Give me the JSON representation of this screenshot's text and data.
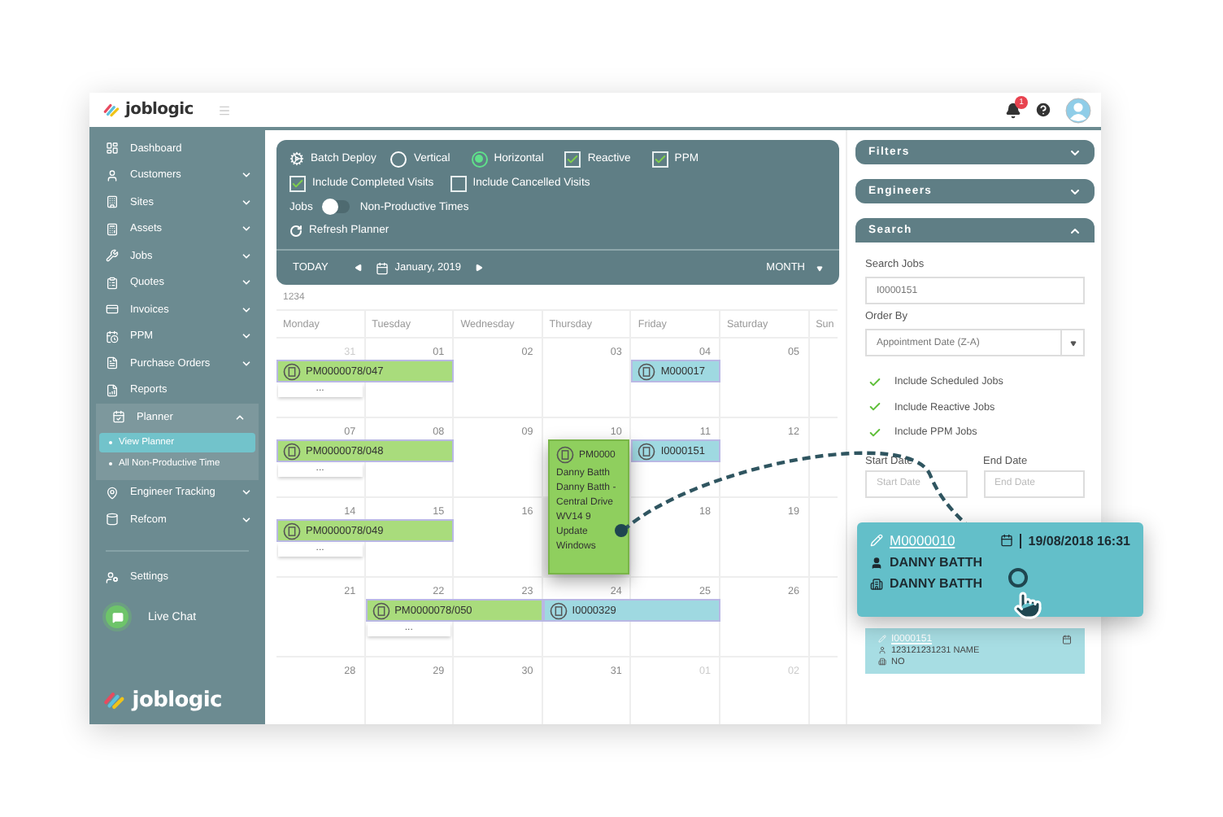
{
  "header": {
    "logo": "joblogic",
    "notifications": "1"
  },
  "sidebar": {
    "items": [
      {
        "label": "Dashboard",
        "kind": "link"
      },
      {
        "label": "Customers",
        "kind": "group",
        "expanded": false
      },
      {
        "label": "Sites",
        "kind": "group",
        "expanded": false
      },
      {
        "label": "Assets",
        "kind": "group",
        "expanded": false
      },
      {
        "label": "Jobs",
        "kind": "group",
        "expanded": false
      },
      {
        "label": "Quotes",
        "kind": "group",
        "expanded": false
      },
      {
        "label": "Invoices",
        "kind": "group",
        "expanded": false
      },
      {
        "label": "PPM",
        "kind": "group",
        "expanded": false
      },
      {
        "label": "Purchase Orders",
        "kind": "group",
        "expanded": false
      },
      {
        "label": "Reports",
        "kind": "link"
      },
      {
        "label": "Planner",
        "kind": "group",
        "expanded": true,
        "children": [
          {
            "label": "View Planner",
            "selected": true
          },
          {
            "label": "All Non-Productive Time",
            "selected": false
          }
        ]
      },
      {
        "label": "Engineer Tracking",
        "kind": "group",
        "expanded": false
      },
      {
        "label": "Refcom",
        "kind": "group",
        "expanded": false
      }
    ],
    "settings": "Settings",
    "live_chat": "Live Chat",
    "logo": "joblogic"
  },
  "toolbar": {
    "batch_deploy": "Batch Deploy",
    "orientation": [
      {
        "label": "Vertical",
        "selected": false
      },
      {
        "label": "Horizontal",
        "selected": true
      }
    ],
    "types": [
      {
        "label": "Reactive",
        "checked": true
      },
      {
        "label": "PPM",
        "checked": true
      }
    ],
    "visits": [
      {
        "label": "Include Completed Visits",
        "checked": true
      },
      {
        "label": "Include Cancelled Visits",
        "checked": false
      }
    ],
    "toggle": {
      "left": "Jobs",
      "right": "Non-Productive Times",
      "on": false
    },
    "refresh": "Refresh Planner",
    "nav": {
      "today": "TODAY",
      "month": "January, 2019",
      "view": "MONTH"
    }
  },
  "resource_label": "1234",
  "calendar": {
    "days": [
      "Monday",
      "Tuesday",
      "Wednesday",
      "Thursday",
      "Friday",
      "Saturday",
      "Sun"
    ],
    "weeks": [
      {
        "dates": [
          {
            "label": "31",
            "muted": true,
            "events": [
              {
                "code": "PM0000078/047",
                "kind": "ppm_two_days",
                "more": "..."
              }
            ]
          },
          {
            "label": "01",
            "muted": false
          },
          {
            "label": "02",
            "muted": false
          },
          {
            "label": "03",
            "muted": false
          },
          {
            "label": "04",
            "muted": false,
            "events": [
              {
                "code": "M000017",
                "kind": "reactive_one_day"
              }
            ]
          },
          {
            "label": "05",
            "muted": false
          }
        ]
      },
      {
        "dates": [
          {
            "label": "07",
            "muted": false,
            "events": [
              {
                "code": "PM0000078/048",
                "kind": "ppm_two_days",
                "more": "..."
              }
            ]
          },
          {
            "label": "08",
            "muted": false
          },
          {
            "label": "09",
            "muted": false
          },
          {
            "label": "10",
            "muted": false
          },
          {
            "label": "11",
            "muted": false,
            "events": [
              {
                "code": "I0000151",
                "kind": "reactive_one_day"
              }
            ]
          },
          {
            "label": "12",
            "muted": false
          }
        ]
      },
      {
        "dates": [
          {
            "label": "14",
            "muted": false,
            "events": [
              {
                "code": "PM0000078/049",
                "kind": "ppm_two_days",
                "more": "..."
              }
            ]
          },
          {
            "label": "15",
            "muted": false
          },
          {
            "label": "16",
            "muted": false
          },
          {
            "covered": true
          },
          {
            "label": "18",
            "muted": false
          },
          {
            "label": "19",
            "muted": false
          }
        ]
      },
      {
        "dates": [
          {
            "label": "21",
            "muted": false
          },
          {
            "label": "22",
            "muted": false,
            "events": [
              {
                "code": "PM0000078/050",
                "kind": "ppm_two_days",
                "more": "..."
              }
            ]
          },
          {
            "label": "23",
            "muted": false
          },
          {
            "label": "24",
            "muted": false,
            "events": [
              {
                "code": "I0000329",
                "kind": "reactive_two_days"
              }
            ]
          },
          {
            "label": "25",
            "muted": false
          },
          {
            "label": "26",
            "muted": false
          }
        ]
      },
      {
        "dates": [
          {
            "label": "28",
            "muted": false
          },
          {
            "label": "29",
            "muted": false
          },
          {
            "label": "30",
            "muted": false
          },
          {
            "label": "31",
            "muted": false
          },
          {
            "label": "01",
            "muted": true
          },
          {
            "label": "02",
            "muted": true
          }
        ]
      }
    ],
    "open_event": {
      "code": "PM0000",
      "lines": [
        "Danny Batth",
        "Danny Batth -",
        "Central Drive",
        "WV14 9",
        "Update",
        "Windows"
      ]
    }
  },
  "panel": {
    "sections": [
      {
        "title": "Filters",
        "expanded": false
      },
      {
        "title": "Engineers",
        "expanded": false
      },
      {
        "title": "Search",
        "expanded": true
      }
    ],
    "search": {
      "jobs_label": "Search Jobs",
      "jobs_value": "I0000151",
      "order_label": "Order By",
      "order_value": "Appointment Date (Z-A)",
      "options": [
        {
          "label": "Include Scheduled Jobs",
          "checked": true
        },
        {
          "label": "Include Reactive Jobs",
          "checked": true
        },
        {
          "label": "Include PPM Jobs",
          "checked": true
        }
      ],
      "start_label": "Start Date",
      "start_placeholder": "Start Date",
      "end_label": "End Date",
      "end_placeholder": "End Date"
    },
    "result": {
      "code": "I0000151",
      "name": "123121231231 NAME",
      "value": "NO"
    }
  },
  "popup": {
    "code": "M0000010",
    "datetime": "19/08/2018 16:31",
    "engineer": "DANNY BATTH",
    "customer": "DANNY BATTH"
  }
}
